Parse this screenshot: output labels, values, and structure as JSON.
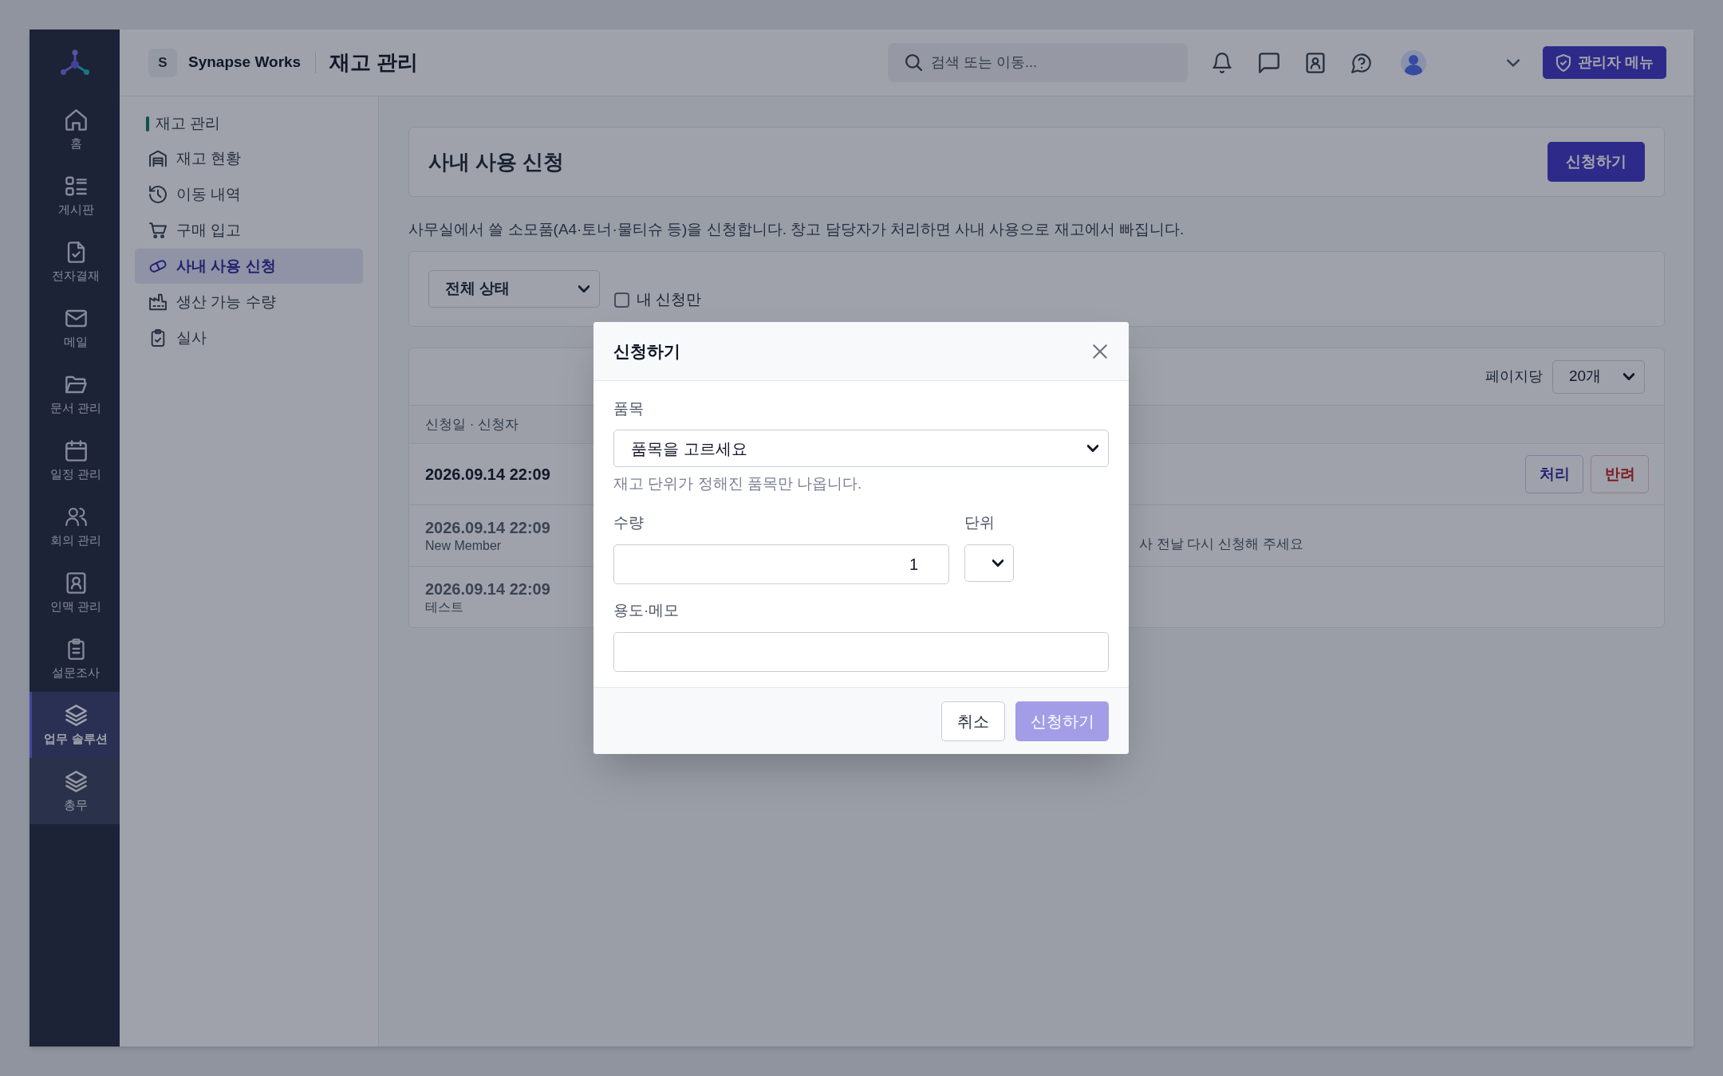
{
  "sidebar": {
    "items": [
      {
        "label": "홈",
        "selected": false,
        "hovered": false
      },
      {
        "label": "게시판",
        "selected": false,
        "hovered": false
      },
      {
        "label": "전자결재",
        "selected": false,
        "hovered": false
      },
      {
        "label": "메일",
        "selected": false,
        "hovered": false
      },
      {
        "label": "문서 관리",
        "selected": false,
        "hovered": false
      },
      {
        "label": "일정 관리",
        "selected": false,
        "hovered": false
      },
      {
        "label": "회의 관리",
        "selected": false,
        "hovered": false
      },
      {
        "label": "인맥 관리",
        "selected": false,
        "hovered": false
      },
      {
        "label": "설문조사",
        "selected": false,
        "hovered": false
      },
      {
        "label": "업무 솔루션",
        "selected": true,
        "hovered": false
      },
      {
        "label": "총무",
        "selected": false,
        "hovered": true
      }
    ]
  },
  "top_bar": {
    "workspace_initial": "S",
    "workspace_name": "Synapse Works",
    "page_title": "재고 관리",
    "search": {
      "placeholder": "검색 또는 이동..."
    },
    "admin_button": "관리자 메뉴"
  },
  "sub_sidebar": {
    "heading": "재고 관리",
    "items": [
      {
        "label": "재고 현황",
        "selected": false
      },
      {
        "label": "이동 내역",
        "selected": false
      },
      {
        "label": "구매 입고",
        "selected": false
      },
      {
        "label": "사내 사용 신청",
        "selected": true
      },
      {
        "label": "생산 가능 수량",
        "selected": false
      },
      {
        "label": "실사",
        "selected": false
      }
    ]
  },
  "page_header": {
    "title": "사내 사용 신청",
    "button": "신청하기"
  },
  "description": "사무실에서 쓸 소모품(A4·토너·물티슈 등)을 신청합니다. 창고 담당자가 처리하면 사내 사용으로 재고에서 빠집니다.",
  "filters": {
    "status_select": "전체 상태",
    "mine_only": {
      "label": "내 신청만",
      "checked": false
    }
  },
  "table": {
    "per_page_label": "페이지당",
    "per_page": "20개",
    "columns": [
      "신청일 · 신청자"
    ],
    "rows": [
      {
        "date": "2026.09.14 22:09",
        "pending": true,
        "actions": [
          {
            "label": "처리",
            "kind": "approve"
          },
          {
            "label": "반려",
            "kind": "reject"
          }
        ]
      },
      {
        "date": "2026.09.14 22:09",
        "requester": "New Member",
        "pending": false,
        "column_3": "사 전날 다시 신청해 주세요"
      },
      {
        "date": "2026.09.14 22:09",
        "requester": "테스트",
        "pending": false
      }
    ]
  },
  "dialog": {
    "title": "신청하기",
    "item": {
      "label": "품목",
      "value": "품목을 고르세요",
      "hint": "재고 단위가 정해진 품목만 나옵니다."
    },
    "quantity": {
      "label": "수량",
      "value": "1"
    },
    "unit": {
      "label": "단위"
    },
    "memo": {
      "label": "용도·메모"
    },
    "buttons": [
      {
        "label": "취소",
        "kind": "cancel",
        "disabled": false
      },
      {
        "label": "신청하기",
        "kind": "submit",
        "disabled": true
      }
    ]
  }
}
